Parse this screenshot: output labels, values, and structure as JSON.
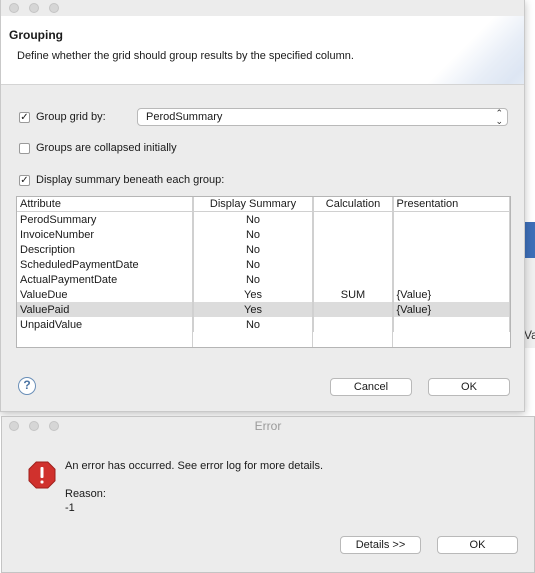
{
  "grouping_dialog": {
    "title": "Grouping",
    "description": "Define whether the grid should group results by the specified column.",
    "group_grid_by": {
      "label": "Group grid by:",
      "checked": true,
      "selected_value": "PerodSummary"
    },
    "collapsed_initially": {
      "label": "Groups are collapsed initially",
      "checked": false
    },
    "display_summary": {
      "label": "Display summary beneath each group:",
      "checked": true
    },
    "table": {
      "headers": [
        "Attribute",
        "Display Summary",
        "Calculation",
        "Presentation"
      ],
      "rows": [
        {
          "attribute": "PerodSummary",
          "display": "No",
          "calculation": "",
          "presentation": ""
        },
        {
          "attribute": "InvoiceNumber",
          "display": "No",
          "calculation": "",
          "presentation": ""
        },
        {
          "attribute": "Description",
          "display": "No",
          "calculation": "",
          "presentation": ""
        },
        {
          "attribute": "ScheduledPaymentDate",
          "display": "No",
          "calculation": "",
          "presentation": ""
        },
        {
          "attribute": "ActualPaymentDate",
          "display": "No",
          "calculation": "",
          "presentation": ""
        },
        {
          "attribute": "ValueDue",
          "display": "Yes",
          "calculation": "SUM",
          "presentation": "{Value}"
        },
        {
          "attribute": "ValuePaid",
          "display": "Yes",
          "calculation": "",
          "presentation": "{Value}"
        },
        {
          "attribute": "UnpaidValue",
          "display": "No",
          "calculation": "",
          "presentation": ""
        }
      ]
    },
    "help_glyph": "?",
    "cancel_label": "Cancel",
    "ok_label": "OK"
  },
  "error_dialog": {
    "title": "Error",
    "message": "An error has occurred. See error log for more details.",
    "reason_label": "Reason:",
    "reason_value": "-1",
    "details_label": "Details >>",
    "ok_label": "OK"
  },
  "background_fragment_text": "Va",
  "colors": {
    "selected_row": "#dcdcdc",
    "error_red": "#d0312d",
    "dialog_bg": "#ececec"
  },
  "icons": [
    "help-icon",
    "error-stop-icon",
    "checkmark-icon",
    "updown-chevron-icon"
  ]
}
